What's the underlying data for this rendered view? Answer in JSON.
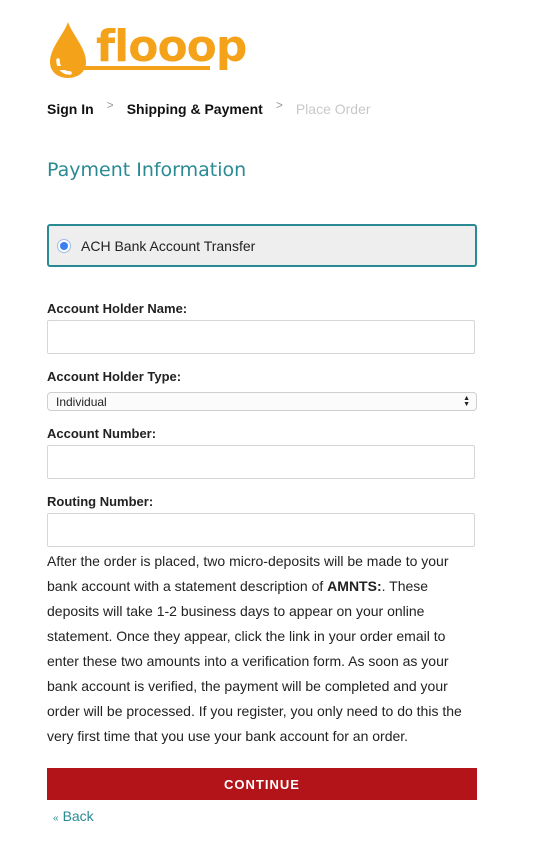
{
  "logo": {
    "text": "flooop",
    "color": "#f5a21b"
  },
  "steps": [
    {
      "label": "Sign In",
      "state": "done"
    },
    {
      "label": "Shipping & Payment",
      "state": "current"
    },
    {
      "label": "Place Order",
      "state": "inactive"
    }
  ],
  "step_separator": ">",
  "payment": {
    "title": "Payment Information",
    "option_label": "ACH Bank Account Transfer",
    "option_selected": true
  },
  "form": {
    "holder_name_label": "Account Holder Name:",
    "holder_name_value": "",
    "holder_type_label": "Account Holder Type:",
    "holder_type_value": "Individual",
    "account_number_label": "Account Number:",
    "account_number_value": "",
    "routing_number_label": "Routing Number:",
    "routing_number_value": ""
  },
  "info": {
    "text_before": "After the order is placed, two micro-deposits will be made to your bank account with a statement description of ",
    "bold": "AMNTS:",
    "text_after": ". These deposits will take 1-2 business days to appear on your online statement. Once they appear, click the link in your order email to enter these two amounts into a verification form. As soon as your bank account is verified, the payment will be completed and your order will be processed. If you register, you only need to do this the very first time that you use your bank account for an order."
  },
  "actions": {
    "continue_label": "CONTINUE",
    "back_chevron": "«",
    "back_label": "Back"
  },
  "colors": {
    "accent_teal": "#2a8a94",
    "continue_red": "#b31419",
    "radio_blue": "#3a7ff2"
  }
}
